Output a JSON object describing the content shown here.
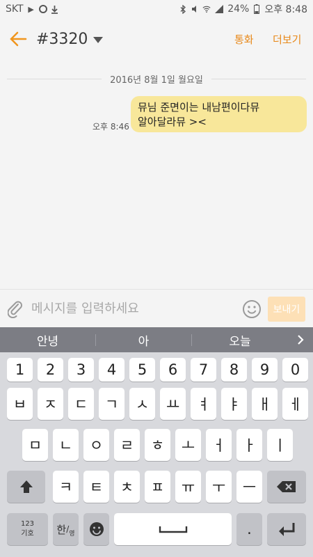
{
  "status_bar": {
    "carrier": "SKT",
    "battery": "24%",
    "time": "오후 8:48"
  },
  "header": {
    "title": "#3320",
    "call_label": "통화",
    "more_label": "더보기"
  },
  "conversation": {
    "date": "2016년 8월 1일 월요일",
    "messages": [
      {
        "time": "오후 8:46",
        "line1": "뮤님 준면이는 내남편이다뮤",
        "line2": "알아달라뮤 ><"
      }
    ]
  },
  "composer": {
    "placeholder": "메시지를 입력하세요",
    "send_label": "보내기"
  },
  "keyboard": {
    "suggestions": [
      "안녕",
      "아",
      "오늘"
    ],
    "row_numbers": [
      "1",
      "2",
      "3",
      "4",
      "5",
      "6",
      "7",
      "8",
      "9",
      "0"
    ],
    "row1": [
      "ㅂ",
      "ㅈ",
      "ㄷ",
      "ㄱ",
      "ㅅ",
      "ㅛ",
      "ㅕ",
      "ㅑ",
      "ㅐ",
      "ㅔ"
    ],
    "row2": [
      "ㅁ",
      "ㄴ",
      "ㅇ",
      "ㄹ",
      "ㅎ",
      "ㅗ",
      "ㅓ",
      "ㅏ",
      "ㅣ"
    ],
    "row3": [
      "ㅋ",
      "ㅌ",
      "ㅊ",
      "ㅍ",
      "ㅠ",
      "ㅜ",
      "ㅡ"
    ],
    "symbols_label_top": "123",
    "symbols_label_bottom": "기호",
    "lang_label_top": "한",
    "lang_label_bottom": "영",
    "period_label": "."
  },
  "colors": {
    "accent": "#f0961e",
    "bubble": "#f8e79a",
    "send_disabled": "#fde0b6",
    "suggestion_bar": "#7c7d84",
    "keyboard_bg": "#d8d9dd"
  }
}
